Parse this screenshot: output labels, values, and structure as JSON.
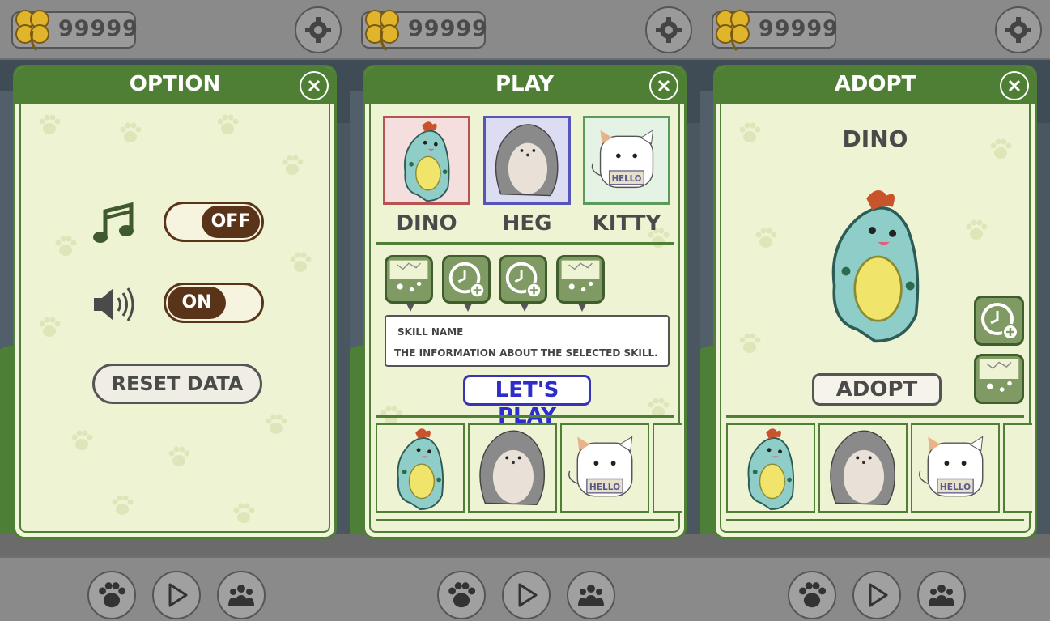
{
  "coins": "99999",
  "colors": {
    "panel_green": "#4f7e35",
    "toggle_brown": "#5a3418",
    "play_blue": "#2d2dcc"
  },
  "icons": [
    "clover-icon",
    "gear-icon",
    "close-icon",
    "paw-icon",
    "play-icon",
    "group-icon",
    "music-icon",
    "speaker-icon",
    "clock-plus-icon",
    "cracked-egg-icon"
  ],
  "option": {
    "title": "OPTION",
    "music_toggle": "OFF",
    "sound_toggle": "ON",
    "reset_label": "RESET DATA"
  },
  "play": {
    "title": "PLAY",
    "characters": [
      {
        "name": "DINO"
      },
      {
        "name": "HEG"
      },
      {
        "name": "KITTY",
        "sign": "HELLO"
      }
    ],
    "skill_name": "SKILL NAME",
    "skill_desc": "THE INFORMATION ABOUT THE SELECTED SKILL.",
    "lets_play": "LET'S PLAY",
    "roster_sign": "HELLO"
  },
  "adopt": {
    "title": "ADOPT",
    "pet_name": "DINO",
    "adopt_label": "ADOPT",
    "roster_sign": "HELLO"
  }
}
